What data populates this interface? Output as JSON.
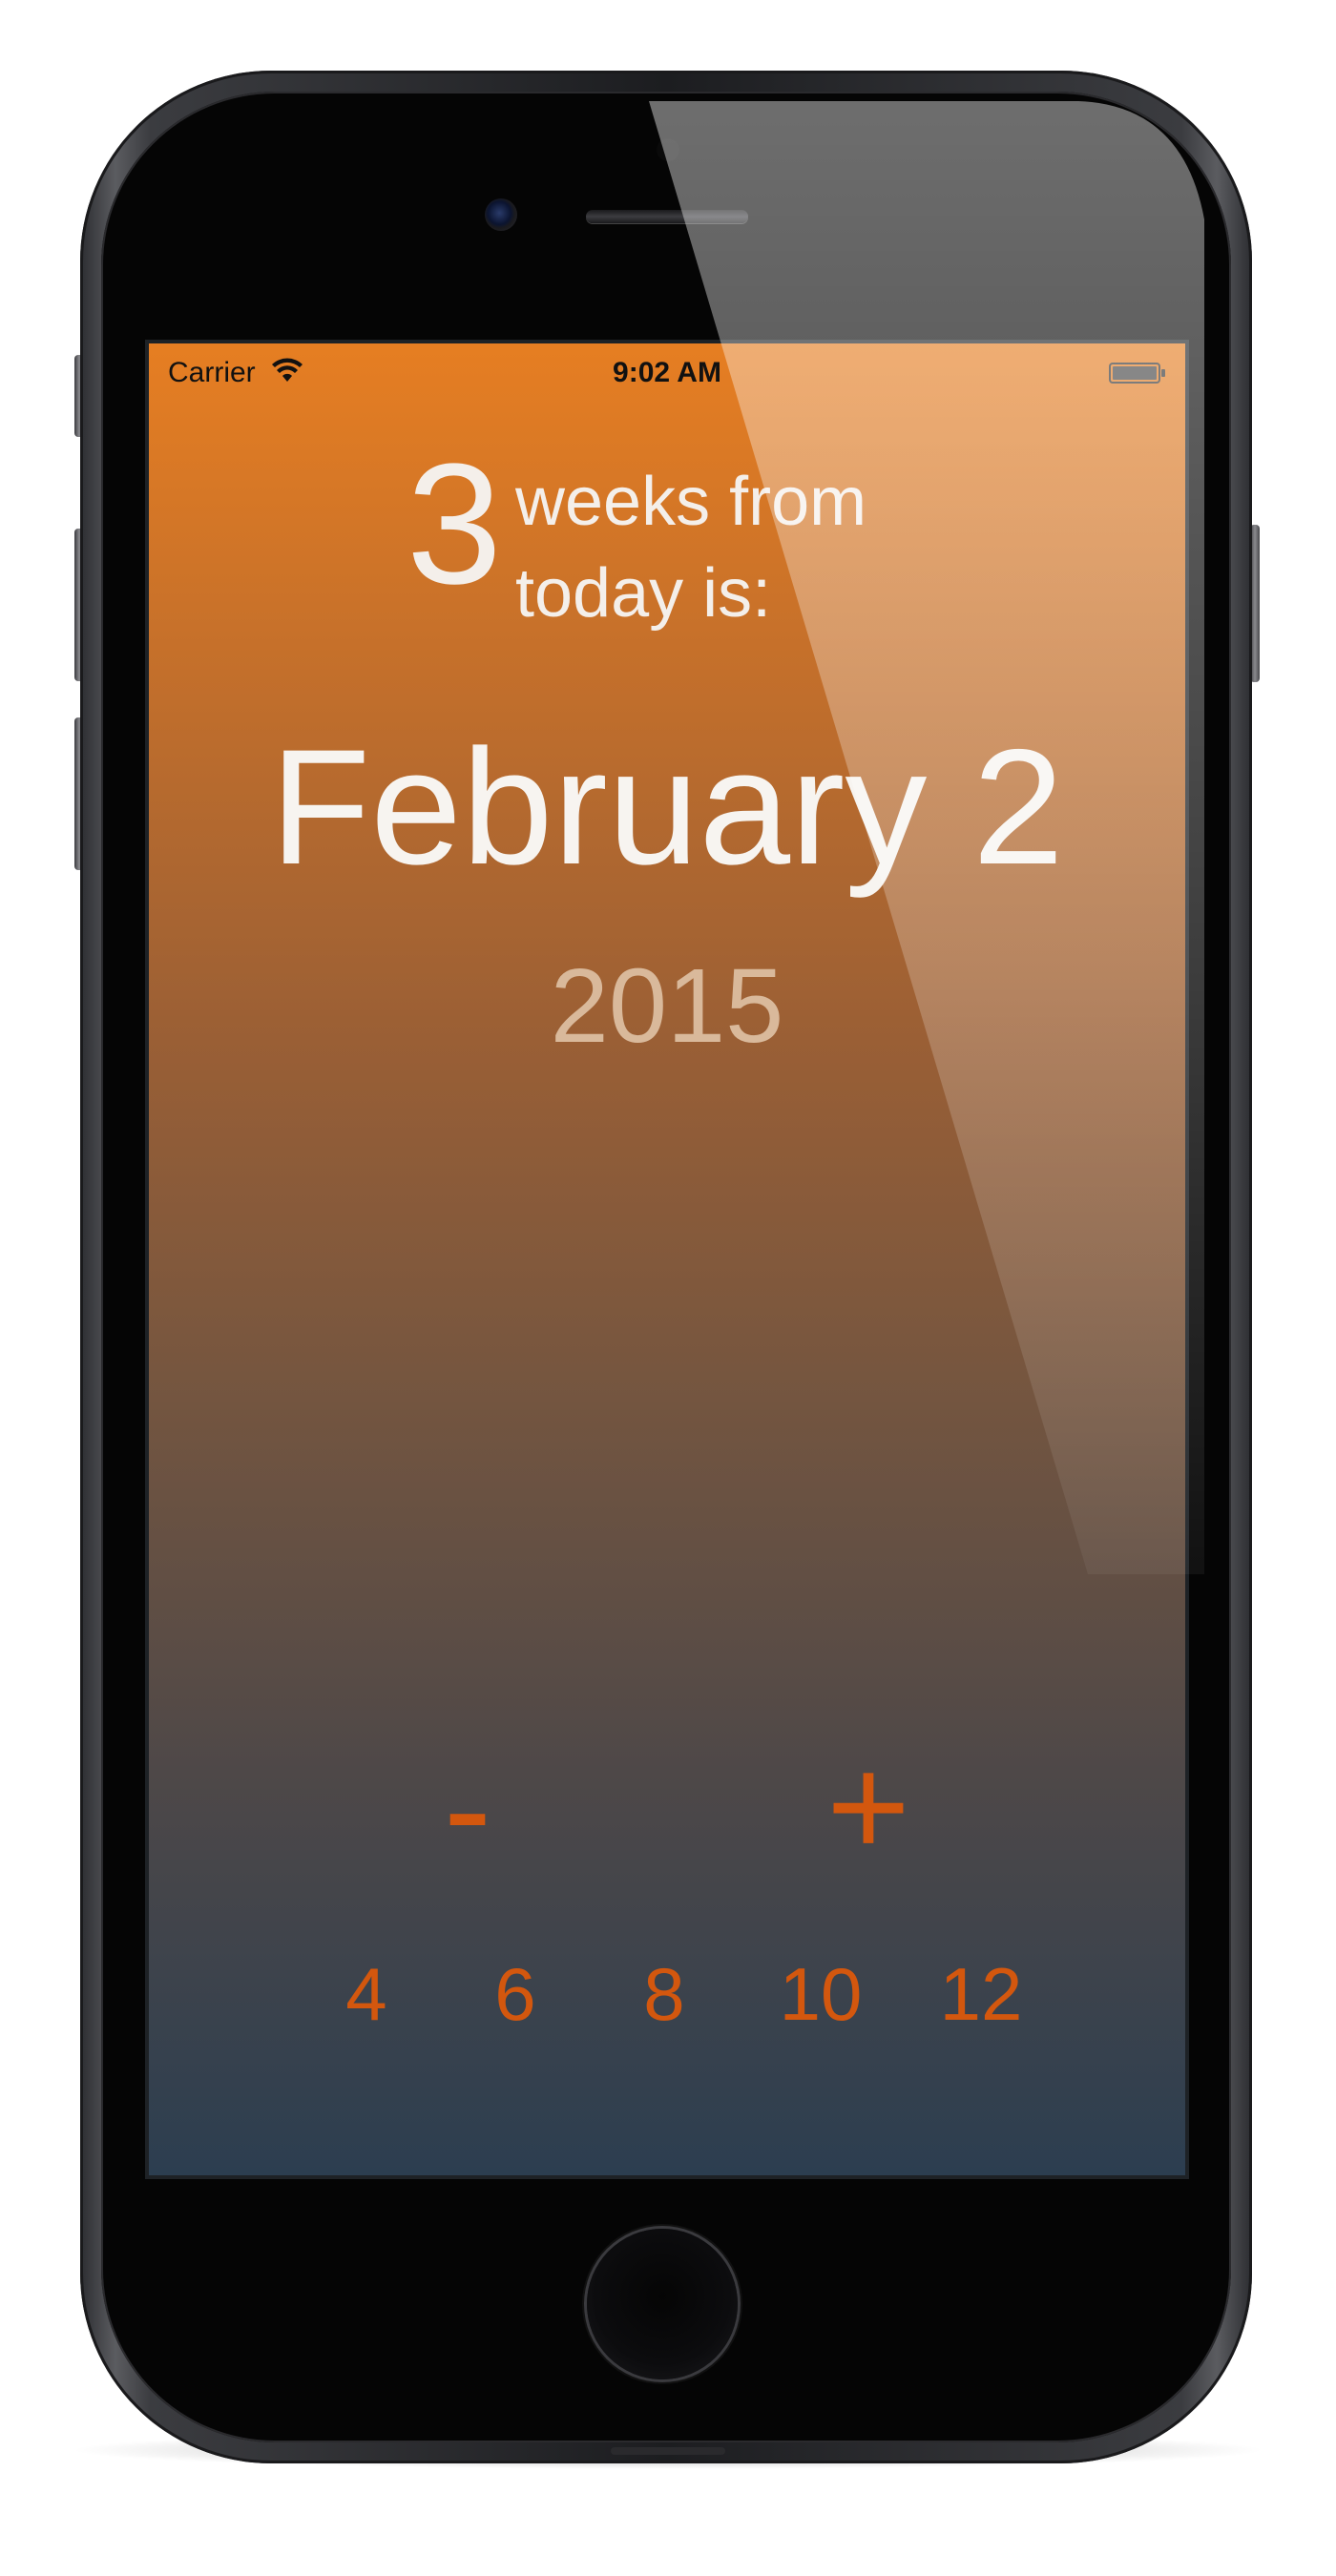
{
  "status_bar": {
    "carrier": "Carrier",
    "time": "9:02 AM",
    "wifi_icon": "wifi-icon",
    "battery_icon": "battery-icon"
  },
  "header": {
    "count": "3",
    "caption_line1": "weeks from",
    "caption_line2": "today is:"
  },
  "result": {
    "date": "February 2",
    "year": "2015"
  },
  "controls": {
    "minus_label": "-",
    "plus_label": "+"
  },
  "presets": [
    "4",
    "6",
    "8",
    "10",
    "12"
  ],
  "colors": {
    "accent": "#d3570e",
    "gradient_top": "#e67e22",
    "gradient_bottom": "#2c3e50",
    "text_primary": "#f4efea",
    "text_year": "#d9b99b"
  }
}
